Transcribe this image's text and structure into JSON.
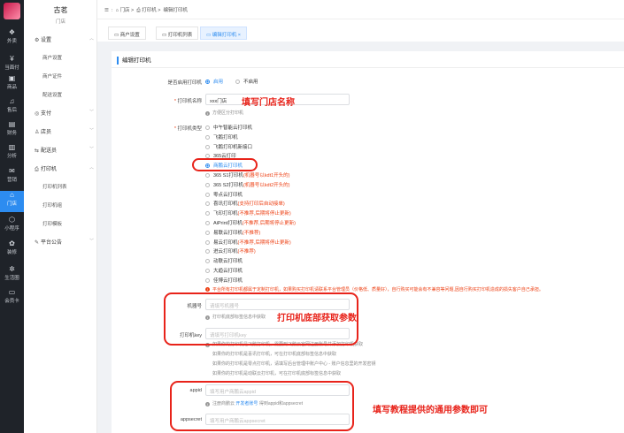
{
  "nav": [
    {
      "icon": "takeout-icon",
      "glyph": "❖",
      "label": "外卖"
    },
    {
      "icon": "pay-icon",
      "glyph": "¥",
      "label": "当面付"
    },
    {
      "icon": "goods-icon",
      "glyph": "▣",
      "label": "商品"
    },
    {
      "icon": "headset-icon",
      "glyph": "♫",
      "label": "售后"
    },
    {
      "icon": "finance-icon",
      "glyph": "▤",
      "label": "财务"
    },
    {
      "icon": "analysis-icon",
      "glyph": "▥",
      "label": "分析"
    },
    {
      "icon": "marketing-icon",
      "glyph": "✉",
      "label": "营销"
    },
    {
      "icon": "store-icon",
      "glyph": "⌂",
      "label": "门店"
    },
    {
      "icon": "miniapp-icon",
      "glyph": "⬡",
      "label": "小程序"
    },
    {
      "icon": "decorate-icon",
      "glyph": "✿",
      "label": "装修"
    },
    {
      "icon": "ecosystem-icon",
      "glyph": "✲",
      "label": "生活圈"
    },
    {
      "icon": "member-card-icon",
      "glyph": "▭",
      "label": "会员卡"
    }
  ],
  "sidebar": {
    "title": "古茗",
    "subtitle": "门店",
    "groups": [
      {
        "icon": "gear-icon",
        "glyph": "⚙",
        "label": "设置"
      },
      {
        "icon": "pay-icon",
        "glyph": "◎",
        "label": "支付"
      },
      {
        "icon": "clerk-icon",
        "glyph": "♙",
        "label": "店员"
      },
      {
        "icon": "delivery-icon",
        "glyph": "⇆",
        "label": "配送员"
      },
      {
        "icon": "printer-icon",
        "glyph": "⎙",
        "label": "打印机"
      },
      {
        "icon": "notice-icon",
        "glyph": "✎",
        "label": "平台公告"
      }
    ],
    "leaves": [
      "商户设置",
      "商户证件",
      "配送设置",
      "打印机列表",
      "打印机组",
      "打印模板"
    ]
  },
  "breadcrumb": {
    "b1": "门店",
    "b2": "打印机",
    "b3": "编辑打印机"
  },
  "tabs": [
    "商户设置",
    "打印机列表",
    "编辑打印机"
  ],
  "form": {
    "section_title": "编辑打印机",
    "enabled_label": "是否启用打印机",
    "enabled_on": "启用",
    "enabled_off": "不启用",
    "name_label": "打印机名称",
    "name_value": "xxx门店",
    "name_hint": "方便区分打印机",
    "type_label": "打印机类型",
    "types": [
      {
        "name": "中午智能云打印机",
        "note": ""
      },
      {
        "name": "飞鹅打印机",
        "note": ""
      },
      {
        "name": "飞鹅打印机新接口",
        "note": ""
      },
      {
        "name": "365云打印",
        "note": ""
      },
      {
        "name": "商鹏云打印机",
        "note": ""
      },
      {
        "name": "365 S1打印机",
        "note": "(机器号以kdt1开头的)"
      },
      {
        "name": "365 S2打印机",
        "note": "(机器号以kdt2开头的)"
      },
      {
        "name": "零点云打印机",
        "note": ""
      },
      {
        "name": "喜讯打印机",
        "note": "(支持打印后自动接单)"
      },
      {
        "name": "飞印打印机",
        "note": "(不推荐,后期将停止更新)"
      },
      {
        "name": "AiPrint打印机",
        "note": "(不推荐,后期将停止更新)"
      },
      {
        "name": "易联云打印机",
        "note": "(不推荐)"
      },
      {
        "name": "易云打印机",
        "note": "(不推荐,后期将停止更新)"
      },
      {
        "name": "进云打印机",
        "note": "(不推荐)"
      },
      {
        "name": "动联云打印机",
        "note": ""
      },
      {
        "name": "大趋云打印机",
        "note": ""
      },
      {
        "name": "佳博云打印机",
        "note": ""
      }
    ],
    "type_warning": "平台所有打印机都属于定制打印机，如果购买打印机请联系平台管理员（价格低、质量好），自行购买可能会有不兼容等问题,因自行购买打印机造成的损失客户自己承担。",
    "sn_label": "机器号",
    "sn_placeholder": "请填写机器号",
    "sn_hint": "打印机底部标签信息中获取",
    "key_label": "打印机key",
    "key_placeholder": "请填写打印机key",
    "key_notes": [
      "如果你的打印机是飞鹅打印机，需要到飞鹅云官网注册账号并添加打印机获取",
      "如果你的打印机是喜讯打印机，可在打印机底部标签信息中获取",
      "如果你的打印机是零点打印机，请填写后台管理中账户中心 - 账户信息里的开发密钥",
      "如果你的打印机是动联云打印机，可在打印机底部标签信息中获取"
    ],
    "appid_label": "appid",
    "appid_placeholder": "填写用户商鹏云appid",
    "appid_hint_pre": "注册商鹏云",
    "appid_hint_link": "开发者账号",
    "appid_hint_post": "得到appid和appsecret",
    "secret_label": "appsecret",
    "secret_placeholder": "填写用户商鹏云appsecret"
  },
  "annotations": {
    "fill_store": "填写门店名称",
    "printer_bottom": "打印机底部获取参数",
    "tutorial": "填写教程提供的通用参数即可"
  },
  "colors": {
    "accent": "#2d8cf0",
    "annotation": "#e8231a",
    "danger": "#ed4014"
  }
}
